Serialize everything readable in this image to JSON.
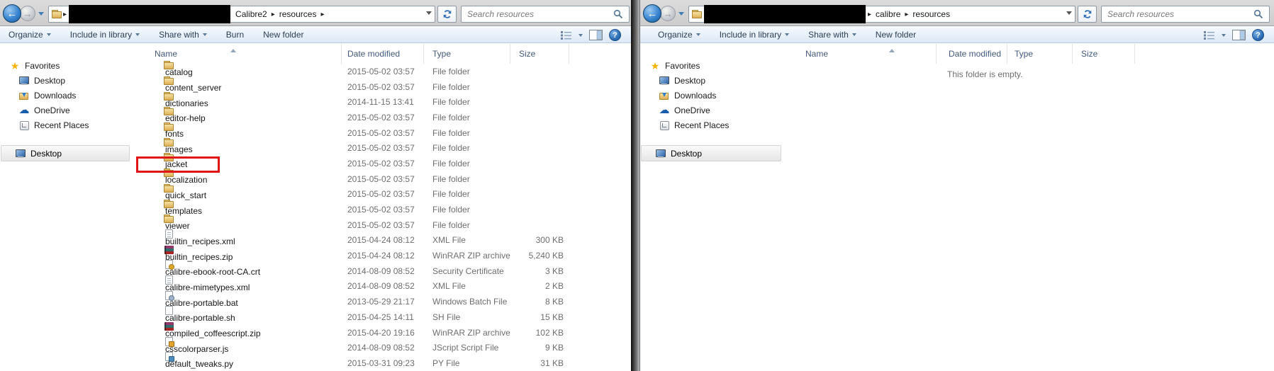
{
  "colors": {
    "highlight_box_red": "#e01515",
    "toolbar_text": "#2b3e54",
    "help_blue": "#2e6fb8"
  },
  "left_window": {
    "nav": {
      "crumb1": "Calibre2",
      "crumb2": "resources",
      "trailing_arrow": "true",
      "search_placeholder": "Search resources",
      "redacted_path": true
    },
    "toolbar": {
      "organize": "Organize",
      "include": "Include in library",
      "share": "Share with",
      "burn": "Burn",
      "new_folder": "New folder"
    },
    "sidebar": {
      "favorites_label": "Favorites",
      "favorites_items": [
        {
          "label": "Desktop",
          "icon": "desktop"
        },
        {
          "label": "Downloads",
          "icon": "downloads"
        },
        {
          "label": "OneDrive",
          "icon": "onedrive"
        },
        {
          "label": "Recent Places",
          "icon": "recent"
        }
      ],
      "tree_items": [
        {
          "label": "Desktop",
          "icon": "desktop",
          "selected": true
        }
      ]
    },
    "list": {
      "columns": {
        "name": "Name",
        "date": "Date modified",
        "type": "Type",
        "size": "Size"
      },
      "sorted_by": "Name",
      "files": [
        {
          "name": "catalog",
          "date": "2015-05-02 03:57",
          "type": "File folder",
          "size": "",
          "icon": "folder"
        },
        {
          "name": "content_server",
          "date": "2015-05-02 03:57",
          "type": "File folder",
          "size": "",
          "icon": "folder"
        },
        {
          "name": "dictionaries",
          "date": "2014-11-15 13:41",
          "type": "File folder",
          "size": "",
          "icon": "folder"
        },
        {
          "name": "editor-help",
          "date": "2015-05-02 03:57",
          "type": "File folder",
          "size": "",
          "icon": "folder"
        },
        {
          "name": "fonts",
          "date": "2015-05-02 03:57",
          "type": "File folder",
          "size": "",
          "icon": "folder"
        },
        {
          "name": "images",
          "date": "2015-05-02 03:57",
          "type": "File folder",
          "size": "",
          "icon": "folder"
        },
        {
          "name": "jacket",
          "date": "2015-05-02 03:57",
          "type": "File folder",
          "size": "",
          "icon": "folder",
          "highlighted": true
        },
        {
          "name": "localization",
          "date": "2015-05-02 03:57",
          "type": "File folder",
          "size": "",
          "icon": "folder"
        },
        {
          "name": "quick_start",
          "date": "2015-05-02 03:57",
          "type": "File folder",
          "size": "",
          "icon": "folder"
        },
        {
          "name": "templates",
          "date": "2015-05-02 03:57",
          "type": "File folder",
          "size": "",
          "icon": "folder"
        },
        {
          "name": "viewer",
          "date": "2015-05-02 03:57",
          "type": "File folder",
          "size": "",
          "icon": "folder"
        },
        {
          "name": "builtin_recipes.xml",
          "date": "2015-04-24 08:12",
          "type": "XML File",
          "size": "300 KB",
          "icon": "xml"
        },
        {
          "name": "builtin_recipes.zip",
          "date": "2015-04-24 08:12",
          "type": "WinRAR ZIP archive",
          "size": "5,240 KB",
          "icon": "zip"
        },
        {
          "name": "calibre-ebook-root-CA.crt",
          "date": "2014-08-09 08:52",
          "type": "Security Certificate",
          "size": "3 KB",
          "icon": "crt"
        },
        {
          "name": "calibre-mimetypes.xml",
          "date": "2014-08-09 08:52",
          "type": "XML File",
          "size": "2 KB",
          "icon": "xml"
        },
        {
          "name": "calibre-portable.bat",
          "date": "2013-05-29 21:17",
          "type": "Windows Batch File",
          "size": "8 KB",
          "icon": "bat"
        },
        {
          "name": "calibre-portable.sh",
          "date": "2015-04-25 14:11",
          "type": "SH File",
          "size": "15 KB",
          "icon": "sh"
        },
        {
          "name": "compiled_coffeescript.zip",
          "date": "2015-04-20 19:16",
          "type": "WinRAR ZIP archive",
          "size": "102 KB",
          "icon": "zip"
        },
        {
          "name": "csscolorparser.js",
          "date": "2014-08-09 08:52",
          "type": "JScript Script File",
          "size": "9 KB",
          "icon": "js"
        },
        {
          "name": "default_tweaks.py",
          "date": "2015-03-31 09:23",
          "type": "PY File",
          "size": "31 KB",
          "icon": "py"
        }
      ]
    }
  },
  "right_window": {
    "nav": {
      "crumb1": "calibre",
      "crumb2": "resources",
      "search_placeholder": "Search resources",
      "redacted_path": true
    },
    "toolbar": {
      "organize": "Organize",
      "include": "Include in library",
      "share": "Share with",
      "new_folder": "New folder"
    },
    "sidebar": {
      "favorites_label": "Favorites",
      "favorites_items": [
        {
          "label": "Desktop",
          "icon": "desktop"
        },
        {
          "label": "Downloads",
          "icon": "downloads"
        },
        {
          "label": "OneDrive",
          "icon": "onedrive"
        },
        {
          "label": "Recent Places",
          "icon": "recent"
        }
      ],
      "tree_items": [
        {
          "label": "Desktop",
          "icon": "desktop",
          "selected": true
        }
      ]
    },
    "list": {
      "columns": {
        "name": "Name",
        "date": "Date modified",
        "type": "Type",
        "size": "Size"
      },
      "sorted_by": "Name",
      "files": [],
      "empty_message": "This folder is empty."
    }
  }
}
